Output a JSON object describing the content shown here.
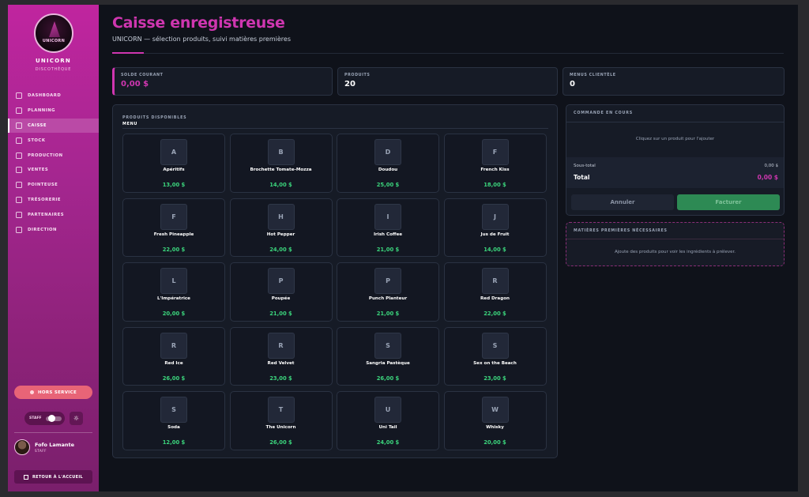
{
  "brand": {
    "logo_text": "UNICORN",
    "name": "UNICORN",
    "subtitle": "DISCOTHÈQUE"
  },
  "nav": [
    {
      "label": "DASHBOARD",
      "icon": "home-icon",
      "active": false
    },
    {
      "label": "PLANNING",
      "icon": "calendar-icon",
      "active": false
    },
    {
      "label": "CAISSE",
      "icon": "cart-icon",
      "active": true
    },
    {
      "label": "STOCK",
      "icon": "box-icon",
      "active": false
    },
    {
      "label": "PRODUCTION",
      "icon": "flask-icon",
      "active": false
    },
    {
      "label": "VENTES",
      "icon": "chart-icon",
      "active": false
    },
    {
      "label": "POINTEUSE",
      "icon": "clock-icon",
      "active": false
    },
    {
      "label": "TRÉSORERIE",
      "icon": "dollar-icon",
      "active": false
    },
    {
      "label": "PARTENAIRES",
      "icon": "users-icon",
      "active": false
    },
    {
      "label": "DIRECTION",
      "icon": "briefcase-icon",
      "active": false
    }
  ],
  "status_button": "HORS SERVICE",
  "toggle_label": "STAFF",
  "user": {
    "name": "Fofo Lamante",
    "role": "STAFF"
  },
  "back_button": "RETOUR À L'ACCUEIL",
  "page": {
    "title": "Caisse enregistreuse",
    "subtitle": "UNICORN — sélection produits, suivi matières premières"
  },
  "stats": [
    {
      "label": "SOLDE COURANT",
      "value": "0,00 $"
    },
    {
      "label": "PRODUITS",
      "value": "20"
    },
    {
      "label": "MENUS CLIENTÈLE",
      "value": "0"
    }
  ],
  "products_panel": {
    "header": "PRODUITS DISPONIBLES",
    "subheader": "MENU"
  },
  "products": [
    {
      "letter": "A",
      "name": "Apéritifs",
      "price": "13,00 $"
    },
    {
      "letter": "B",
      "name": "Brochette Tomate-Mozza",
      "price": "14,00 $"
    },
    {
      "letter": "D",
      "name": "Doudou",
      "price": "25,00 $"
    },
    {
      "letter": "F",
      "name": "French Kiss",
      "price": "18,00 $"
    },
    {
      "letter": "F",
      "name": "Fresh Pineapple",
      "price": "22,00 $"
    },
    {
      "letter": "H",
      "name": "Hot Pepper",
      "price": "24,00 $"
    },
    {
      "letter": "I",
      "name": "Irish Coffee",
      "price": "21,00 $"
    },
    {
      "letter": "J",
      "name": "Jus de Fruit",
      "price": "14,00 $"
    },
    {
      "letter": "L",
      "name": "L'Impératrice",
      "price": "20,00 $"
    },
    {
      "letter": "P",
      "name": "Poupée",
      "price": "21,00 $"
    },
    {
      "letter": "P",
      "name": "Punch Planteur",
      "price": "21,00 $"
    },
    {
      "letter": "R",
      "name": "Red Dragon",
      "price": "22,00 $"
    },
    {
      "letter": "R",
      "name": "Red Ice",
      "price": "26,00 $"
    },
    {
      "letter": "R",
      "name": "Red Velvet",
      "price": "23,00 $"
    },
    {
      "letter": "S",
      "name": "Sangria Pastèque",
      "price": "26,00 $"
    },
    {
      "letter": "S",
      "name": "Sex on the Beach",
      "price": "23,00 $"
    },
    {
      "letter": "S",
      "name": "Soda",
      "price": "12,00 $"
    },
    {
      "letter": "T",
      "name": "The Unicorn",
      "price": "26,00 $"
    },
    {
      "letter": "U",
      "name": "Uni Tail",
      "price": "24,00 $"
    },
    {
      "letter": "W",
      "name": "Whisky",
      "price": "20,00 $"
    }
  ],
  "order": {
    "header": "COMMANDE EN COURS",
    "empty": "Cliquez sur un produit pour l'ajouter",
    "subtotal_label": "Sous-total",
    "subtotal_value": "0,00 $",
    "total_label": "Total",
    "total_value": "0,00 $",
    "cancel": "Annuler",
    "invoice": "Facturer"
  },
  "ingredients": {
    "header": "MATIÈRES PREMIÈRES NÉCESSAIRES",
    "empty": "Ajoute des produits pour voir les ingrédients à prélever."
  },
  "colors": {
    "accent": "#cf36b0",
    "price": "#3bd47c",
    "success": "#2d8a54",
    "danger": "#e86477"
  }
}
